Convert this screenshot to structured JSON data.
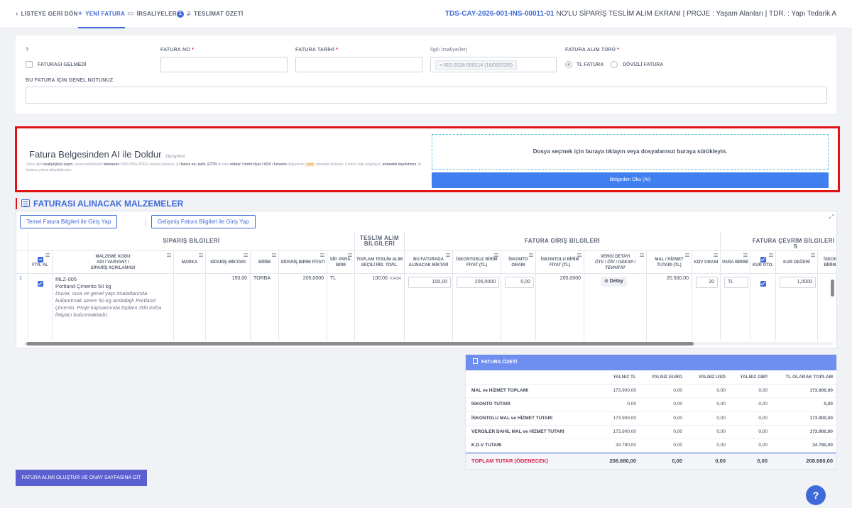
{
  "nav": {
    "back": "LİSTEYE GERİ DÖN",
    "new_invoice": "YENİ FATURA",
    "irsaliye": "İRSALİYELER",
    "irsaliye_count": "1",
    "summary": "TESLİMAT ÖZETİ"
  },
  "header": {
    "code": "TDS-CAY-2026-001-INS-00011-01",
    "title": " NO'LU SİPARİŞ TESLİM ALIM EKRANI | PROJE : Yaşam Alanları | TDR. : Yapı Tedarik A"
  },
  "form": {
    "q_label": "?",
    "no_invoice_label": "FATURASI GELMEDİ",
    "invoice_no_label": "FATURA NO",
    "invoice_date_label": "FATURA TARİHİ",
    "irsaliye_label": "İlgili İrsaliye(ler)",
    "irsaliye_tag": "× IRS-2026-000214 (18/09/2026)",
    "type_label": "FATURA ALIM TÜRÜ",
    "type_tl": "TL FATURA",
    "type_fx": "DÖVİZLİ FATURA",
    "note_label": "BU FATURA İÇİN GENEL NOTUNUZ",
    "req": "*"
  },
  "ai": {
    "title": "Fatura Belgesinden AI ile Doldur",
    "optional": "Opsiyonel",
    "desc_1": "Önce ilgili ",
    "desc_b1": "irsaliye(ler)i seçin",
    "desc_2": ", sonra tedarikçinin ",
    "desc_b2": "faturasını",
    "desc_3": " (PDF/PNG/JPEG) buraya yükleyin. AI ",
    "desc_b3": "fatura no, tarih, ETTN",
    "desc_4": " ile satır ",
    "desc_b4": "miktar / birim fiyat / KDV / İskonto",
    "desc_5": " değerlerini ",
    "desc_hl": "satır",
    "desc_6": " otomatik doldurur. Kontrol edip onaylayın; ",
    "desc_b5": "otomatik kaydetmez",
    "desc_7": ". AI kotanız yoksa atlayabilirsiniz.",
    "dropzone": "Dosya seçmek için buraya tıklayın veya dosyalarınızı buraya sürükleyin.",
    "read_button": "Belgeden Oku (AI)"
  },
  "materials": {
    "title": "FATURASI ALINACAK MALZEMELER",
    "btn_basic": "Temel Fatura Bilgileri ile Giriş Yap",
    "btn_adv": "Gelişmiş Fatura Bilgileri ile Giriş Yap",
    "expand": "⤢",
    "groups": {
      "order": "SİPARİŞ BİLGİLERİ",
      "delivery": "TESLİM ALIM BİLGİLERİ",
      "invoice": "FATURA GİRİŞ BİLGİLERİ",
      "conversion": "FATURA ÇEVRİM BİLGİLERİ ( S"
    },
    "cols": {
      "ftr_al": "Ftr. AL",
      "code_1": "MALZEME KODU",
      "code_2": "ADI / VARYANT /",
      "code_3": "SİPARİŞ AÇIKLAMASI",
      "brand": "MARKA",
      "qty": "SİPARİŞ MİKTARI",
      "unit": "BİRİM",
      "unit_price": "SİPARİŞ BİRİM FİYATI",
      "currency": "SİP. PARA. BRM",
      "total_1": "TOPLAM TESLİM ALIM",
      "total_2": "SEÇİLİ İRS. TOPL.",
      "inv_qty": "BU FATURADA ALINACAK MİKTAR",
      "disc_price": "İSKONTOSUZ BİRİM FİYAT (TL)",
      "disc_rate": "İSKONTO ORANI",
      "net_price": "İSKONTOLU BİRİM FİYAT (TL)",
      "tax_1": "VERGİ DETAYI",
      "tax_2": "ÖTV / ÖİV / GEKAP /",
      "tax_3": "Tevkifat",
      "line_total": "MAL / HİZMET TUTARI (TL)",
      "kdv": "KDV Oranı",
      "pcur": "PARA BİRİMİ",
      "rate_auto": "Kur Oto.",
      "rate": "KUR DEĞERİ",
      "iskont": "İSKONT BİRİM F"
    },
    "row": {
      "num": "1",
      "code": "MLZ-005",
      "name": "Portland Çimento 50 kg",
      "note": "Duvar, sıva ve genel yapı imalatlarında kullanılmak üzere 50 kg ambalajlı Portland çimento. Proje kapsamında toplam 300 torba ihtiyacı bulunmaktadır.",
      "qty": "150,00",
      "unit": "TORBA",
      "unit_price": "205,0000",
      "currency": "TL",
      "total": "100,00",
      "total_unit": "TORBA",
      "inv_qty": "100,00",
      "disc_price": "205,0000",
      "disc_rate": "0,00",
      "net_price": "205,0000",
      "detail_btn": "⊘ Detay",
      "line_total": "20.500,00",
      "kdv": "20",
      "pcur": "TL",
      "rate": "1,0000"
    }
  },
  "summary": {
    "title": "FATURA ÖZETİ",
    "cols": [
      "YALNIZ TL",
      "YALNIZ EURO",
      "YALNIZ USD",
      "YALNIZ GBP",
      "TL OLARAK TOPLAM"
    ],
    "rows": [
      {
        "label": "MAL ve HİZMET TOPLAMI",
        "v": [
          "173.900,00",
          "0,00",
          "0,00",
          "0,00",
          "173.900,00"
        ]
      },
      {
        "label": "İSKONTO TUTARI",
        "v": [
          "0,00",
          "0,00",
          "0,00",
          "0,00",
          "0,00"
        ]
      },
      {
        "label": "İSKONTOLU MAL ve HİZMET TUTARI",
        "v": [
          "173.900,00",
          "0,00",
          "0,00",
          "0,00",
          "173.900,00"
        ]
      },
      {
        "label": "VERGİLER DAHİL MAL ve HİZMET TUTARI",
        "v": [
          "173.900,00",
          "0,00",
          "0,00",
          "0,00",
          "173.900,00"
        ]
      },
      {
        "label": "K.D.V TUTARI",
        "v": [
          "34.780,00",
          "0,00",
          "0,00",
          "0,00",
          "34.780,00"
        ]
      }
    ],
    "total": {
      "label": "TOPLAM TUTAR (ÖDENECEK)",
      "v": [
        "208.680,00",
        "0,00",
        "0,00",
        "0,00",
        "208.680,00"
      ]
    }
  },
  "submit_button": "FATURA ALIMI OLUŞTUR VE ONAY SAYFASINA GİT",
  "help": "?",
  "colors": {
    "accent": "#3f6ad8",
    "ai_button": "#3f7ff0",
    "highlight_border": "#e01414",
    "submit": "#5b5fd0",
    "danger_text": "#d92550"
  }
}
